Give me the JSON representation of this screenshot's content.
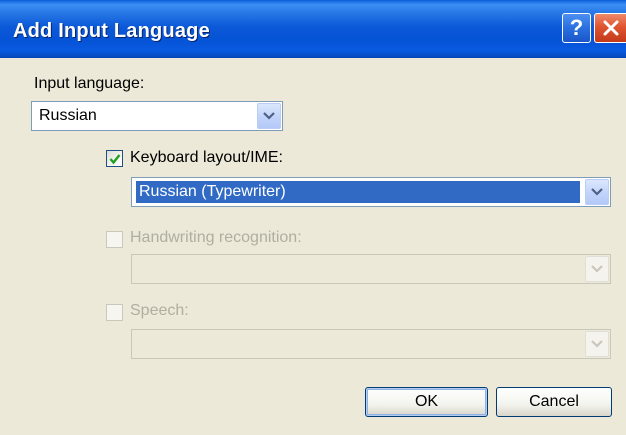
{
  "window": {
    "title": "Add Input Language",
    "help_glyph": "?",
    "help_icon": "help-icon",
    "close_icon": "close-icon"
  },
  "input_language": {
    "label": "Input language:",
    "value": "Russian"
  },
  "keyboard_layout": {
    "label": "Keyboard layout/IME:",
    "checked": true,
    "value": "Russian (Typewriter)"
  },
  "handwriting": {
    "label": "Handwriting recognition:",
    "checked": false,
    "enabled": false,
    "value": ""
  },
  "speech": {
    "label": "Speech:",
    "checked": false,
    "enabled": false,
    "value": ""
  },
  "buttons": {
    "ok_label": "OK",
    "cancel_label": "Cancel"
  },
  "colors": {
    "titlebar_blue": "#0553d6",
    "dialog_face": "#ece9d8",
    "selection": "#316ac5",
    "close_red": "#e05530"
  }
}
